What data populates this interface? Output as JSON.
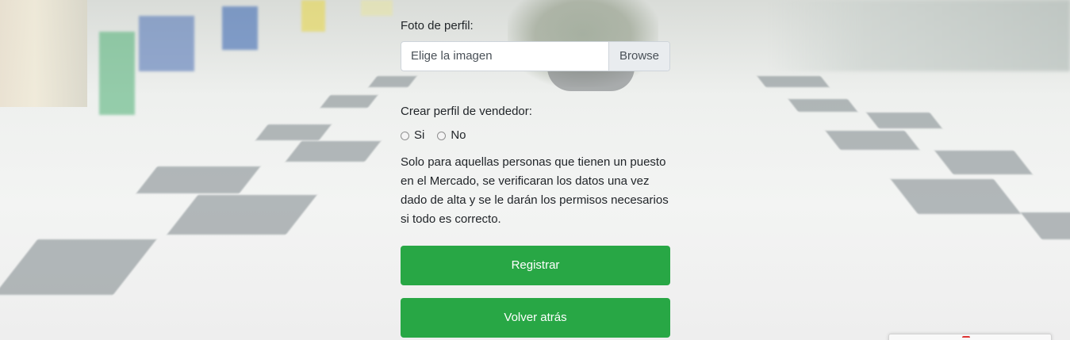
{
  "form": {
    "photo_label": "Foto de perfil:",
    "file_placeholder": "Elige la imagen",
    "browse_label": "Browse",
    "seller_label": "Crear perfil de vendedor:",
    "radio_options": [
      {
        "label": "Si",
        "checked": false
      },
      {
        "label": "No",
        "checked": false
      }
    ],
    "note": "Solo para aquellas personas que tienen un puesto en el Mercado, se verificaran los datos una vez dado de alta y se le darán los permisos necesarios si todo es correcto.",
    "register_label": "Registrar",
    "back_label": "Volver atrás"
  },
  "colors": {
    "primary_button": "#28a745",
    "button_text": "#ffffff",
    "input_border": "#ced4da",
    "browse_bg": "#e9ecef"
  }
}
